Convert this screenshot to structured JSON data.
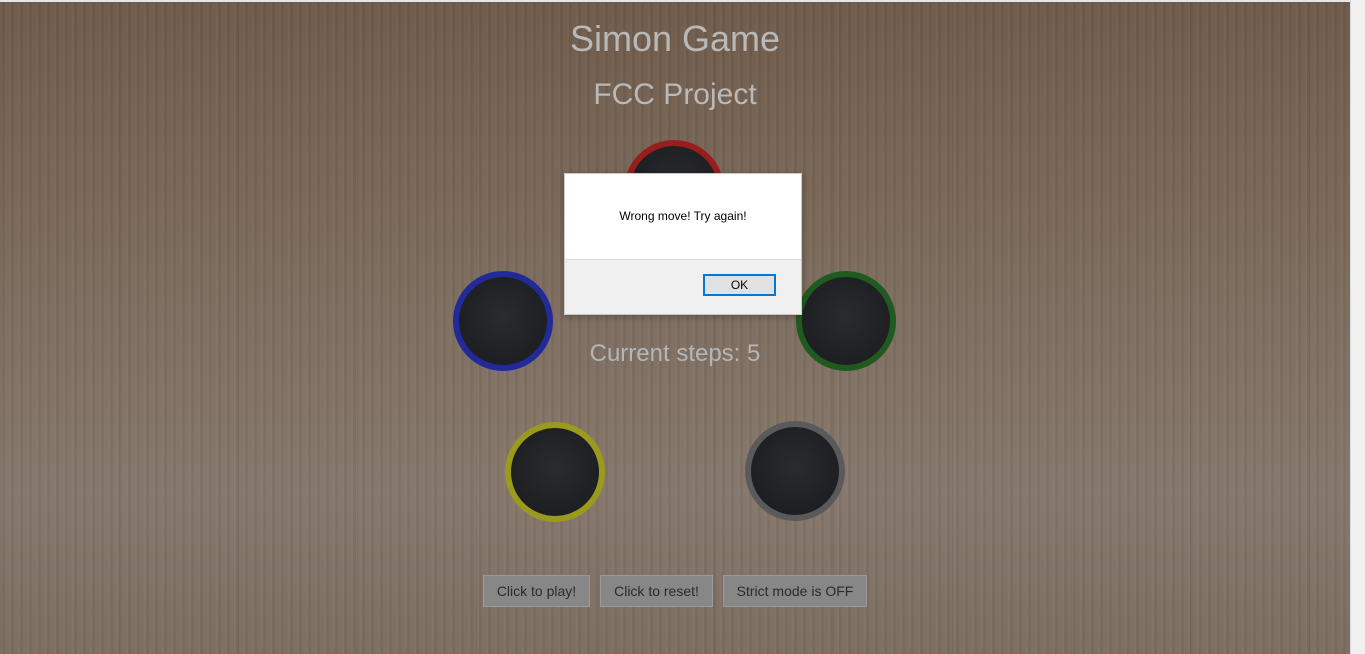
{
  "header": {
    "title": "Simon Game",
    "subtitle": "FCC Project"
  },
  "board": {
    "steps_text": "Current steps: 5",
    "pads": [
      {
        "name": "red",
        "color": "#9a1d1d"
      },
      {
        "name": "blue",
        "color": "#222a9a"
      },
      {
        "name": "green",
        "color": "#1f5a1f"
      },
      {
        "name": "yellow",
        "color": "#9a9a1c"
      },
      {
        "name": "gray",
        "color": "#5a5a5c"
      }
    ]
  },
  "controls": {
    "play_label": "Click to play!",
    "reset_label": "Click to reset!",
    "strict_label": "Strict mode is OFF"
  },
  "alert": {
    "message": "Wrong move! Try again!",
    "ok_label": "OK"
  }
}
